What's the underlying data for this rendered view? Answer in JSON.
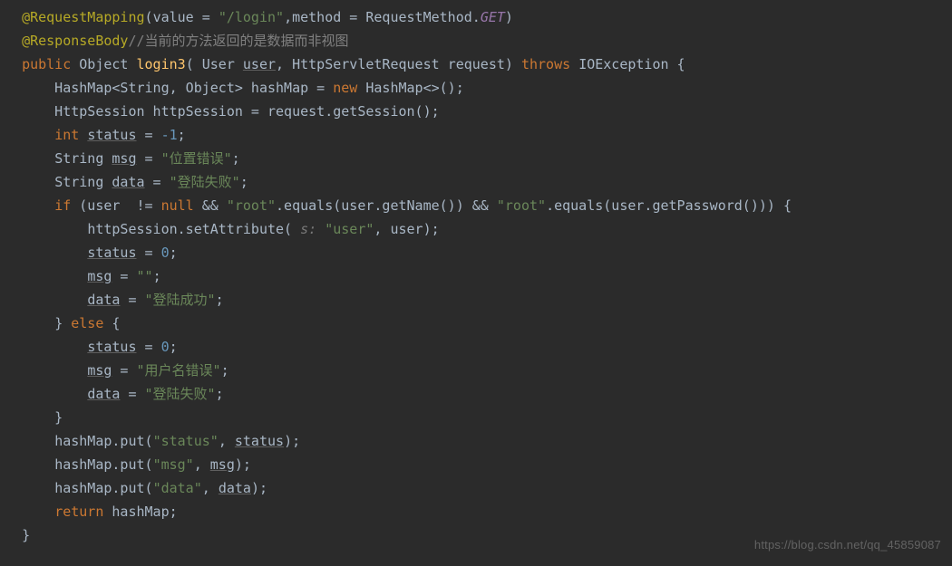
{
  "watermark": "https://blog.csdn.net/qq_45859087",
  "code": {
    "l1": {
      "ann": "@RequestMapping",
      "open": "(",
      "p1": "value = ",
      "s1": "\"/login\"",
      "c": ",",
      "p2": "method = ",
      "rm": "RequestMethod.",
      "get": "GET",
      "close": ")"
    },
    "l2": {
      "ann": "@ResponseBody",
      "cmt": "//当前的方法返回的是数据而非视图"
    },
    "l3": {
      "kw": "public",
      "sp": " ",
      "t": "Object ",
      "fn": "login3",
      "sig1": "( User ",
      "u": "user",
      "sig2": ", HttpServletRequest ",
      "req": "request",
      "sig3": ") ",
      "thr": "throws",
      "sp2": " ",
      "ex": "IOException",
      "br": " {"
    },
    "l4": {
      "txt": "    HashMap<String, Object> hashMap = ",
      "kw": "new",
      "rest": " HashMap<>();"
    },
    "l5": {
      "txt": "    HttpSession httpSession = request.getSession();"
    },
    "l6": {
      "pad": "    ",
      "kw": "int",
      "sp": " ",
      "var": "status",
      "eq": " = ",
      "num": "-1",
      "sc": ";"
    },
    "l7": {
      "pad": "    ",
      "t": "String ",
      "var": "msg",
      "eq": " = ",
      "s": "\"位置错误\"",
      "sc": ";"
    },
    "l8": {
      "pad": "    ",
      "t": "String ",
      "var": "data",
      "eq": " = ",
      "s": "\"登陆失败\"",
      "sc": ";"
    },
    "l9": {
      "pad": "    ",
      "kw": "if",
      "open": " (user  != ",
      "nul": "null",
      "amp": " && ",
      "s1": "\"root\"",
      "mid1": ".equals(user.getName()) && ",
      "s2": "\"root\"",
      "mid2": ".equals(user.getPassword())) {"
    },
    "l10": {
      "pad": "        ",
      "pre": "httpSession.setAttribute( ",
      "hint": "s: ",
      "s": "\"user\"",
      "rest": ", user);"
    },
    "l11": {
      "pad": "        ",
      "var": "status",
      "eq": " = ",
      "num": "0",
      "sc": ";"
    },
    "l12": {
      "pad": "        ",
      "var": "msg",
      "eq": " = ",
      "s": "\"\"",
      "sc": ";"
    },
    "l13": {
      "pad": "        ",
      "var": "data",
      "eq": " = ",
      "s": "\"登陆成功\"",
      "sc": ";"
    },
    "l14": {
      "pad": "    ",
      "close": "} ",
      "kw": "else",
      "br": " {"
    },
    "l15": {
      "pad": "        ",
      "var": "status",
      "eq": " = ",
      "num": "0",
      "sc": ";"
    },
    "l16": {
      "pad": "        ",
      "var": "msg",
      "eq": " = ",
      "s": "\"用户名错误\"",
      "sc": ";"
    },
    "l17": {
      "pad": "        ",
      "var": "data",
      "eq": " = ",
      "s": "\"登陆失败\"",
      "sc": ";"
    },
    "l18": {
      "txt": "    }"
    },
    "l19": {
      "pad": "    ",
      "pre": "hashMap.put(",
      "s": "\"status\"",
      "mid": ", ",
      "var": "status",
      "end": ");"
    },
    "l20": {
      "pad": "    ",
      "pre": "hashMap.put(",
      "s": "\"msg\"",
      "mid": ", ",
      "var": "msg",
      "end": ");"
    },
    "l21": {
      "pad": "    ",
      "pre": "hashMap.put(",
      "s": "\"data\"",
      "mid": ", ",
      "var": "data",
      "end": ");"
    },
    "l22": {
      "pad": "    ",
      "kw": "return",
      "rest": " hashMap;"
    },
    "l23": {
      "txt": "}"
    }
  }
}
